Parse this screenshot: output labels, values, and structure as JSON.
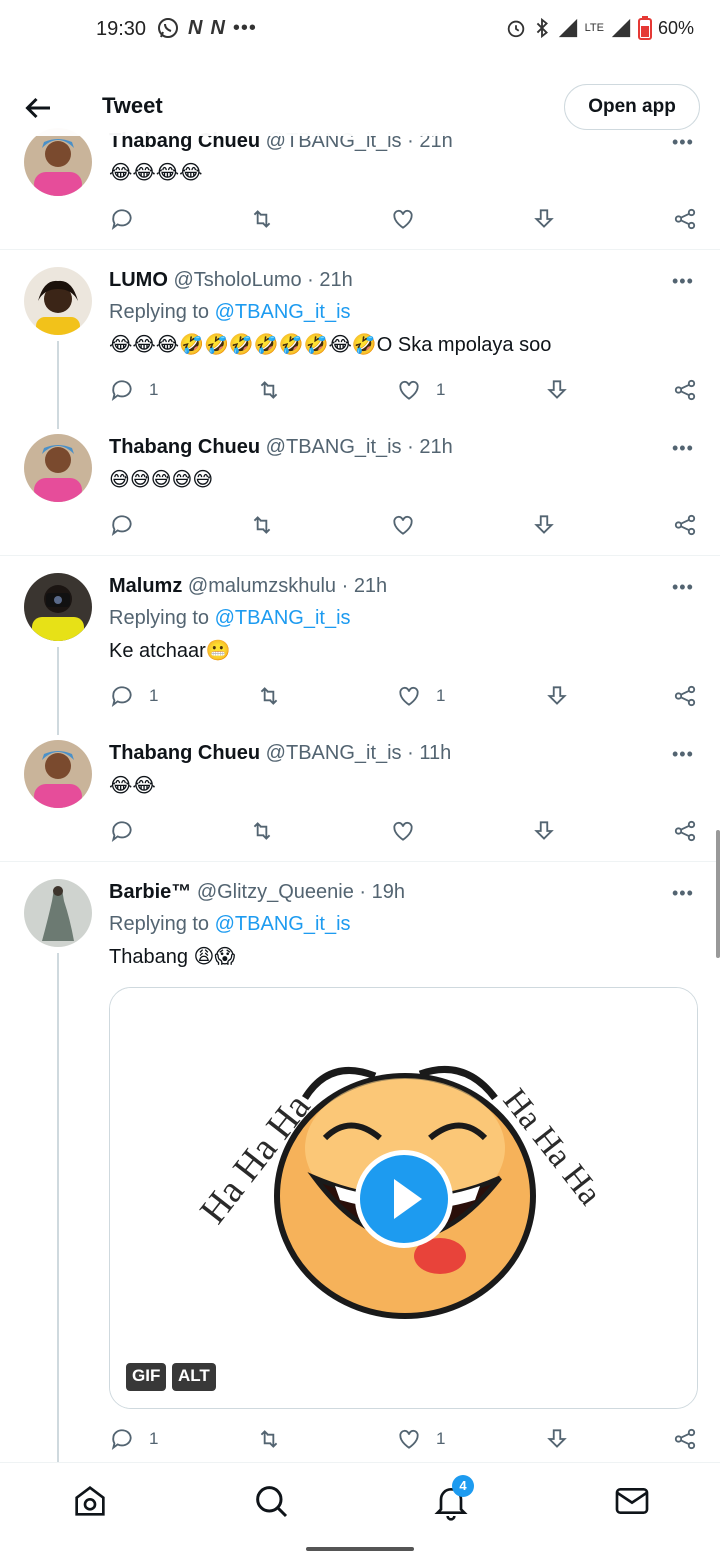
{
  "status": {
    "time": "19:30",
    "battery": "60%",
    "network": "LTE",
    "notif_n": "N"
  },
  "header": {
    "title": "Tweet",
    "open_app": "Open app"
  },
  "tweets": [
    {
      "name": "Thabang Chueu",
      "handle": "@TBANG_it_is",
      "time": "21h",
      "text": "😂😂😂😂"
    },
    {
      "name": "LUMO",
      "handle": "@TsholoLumo",
      "time": "21h",
      "replying_prefix": "Replying to",
      "replying_to": "@TBANG_it_is",
      "emojis": "😂😂😂🤣🤣🤣🤣🤣🤣😂🤣",
      "text": "O Ska mpolaya soo",
      "reply_count": "1",
      "like_count": "1"
    },
    {
      "name": "Thabang Chueu",
      "handle": "@TBANG_it_is",
      "time": "21h",
      "text": "😅😅😅😅😅"
    },
    {
      "name": "Malumz",
      "handle": "@malumzskhulu",
      "time": "21h",
      "replying_prefix": "Replying to",
      "replying_to": "@TBANG_it_is",
      "text": "Ke atchaar",
      "emojis": "😬",
      "reply_count": "1",
      "like_count": "1"
    },
    {
      "name": "Thabang Chueu",
      "handle": "@TBANG_it_is",
      "time": "11h",
      "text": "😂😂"
    },
    {
      "name": "Barbie™",
      "handle": "@Glitzy_Queenie",
      "time": "19h",
      "replying_prefix": "Replying to",
      "replying_to": "@TBANG_it_is",
      "text": "Thabang",
      "emojis": "😩😱",
      "reply_count": "1",
      "like_count": "1",
      "media": {
        "gif_label": "GIF",
        "alt_label": "ALT",
        "caption_left": "Ha Ha Ha",
        "caption_right": "Ha Ha Ha"
      }
    }
  ],
  "nav": {
    "notification_count": "4"
  },
  "colors": {
    "accent": "#1d9bf0",
    "text": "#0f1419",
    "muted": "#536471",
    "border": "#eff3f4"
  }
}
